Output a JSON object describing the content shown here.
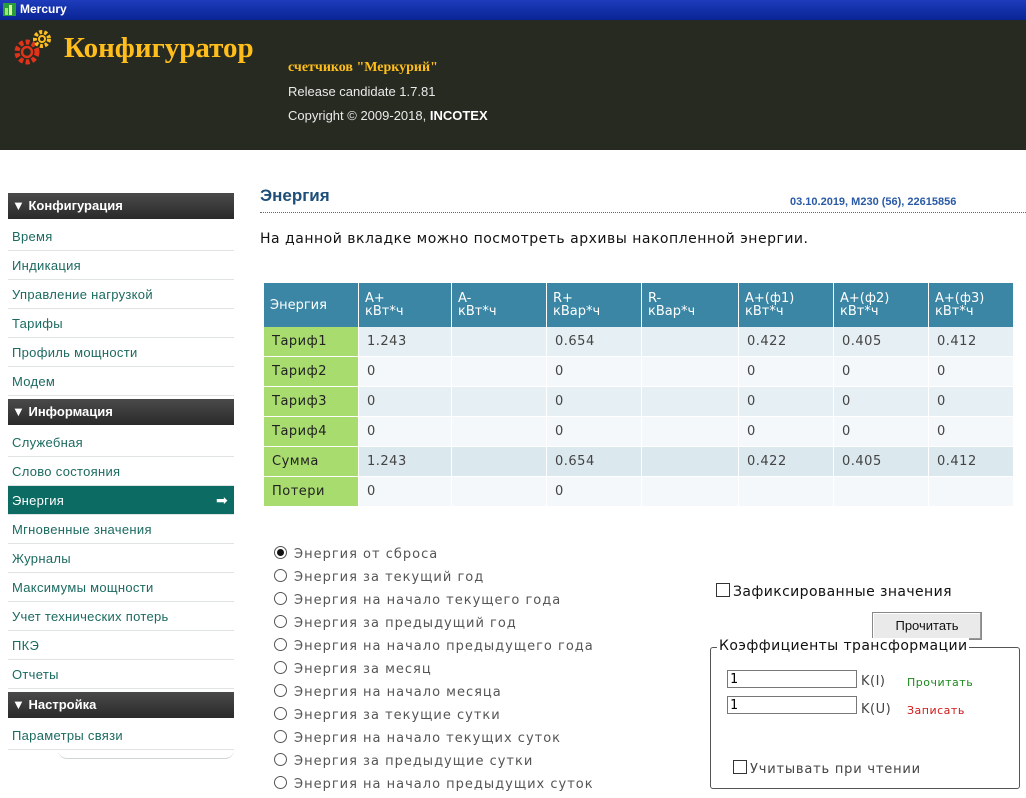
{
  "window": {
    "title": "Mercury"
  },
  "header": {
    "brand": "Конфигуратор",
    "subtitle": "счетчиков \"Меркурий\"",
    "release": "Release candidate 1.7.81",
    "copyright_prefix": "Copyright © 2009-2018, ",
    "copyright_company": "INCOTEX"
  },
  "sidebar": {
    "sections": [
      {
        "title": "▼ Конфигурация",
        "items": [
          "Время",
          "Индикация",
          "Управление нагрузкой",
          "Тарифы",
          "Профиль мощности",
          "Модем"
        ]
      },
      {
        "title": "▼ Информация",
        "items": [
          "Служебная",
          "Слово состояния",
          "Энергия",
          "Мгновенные значения",
          "Журналы",
          "Максимумы мощности",
          "Учет технических потерь",
          "ПКЭ",
          "Отчеты"
        ]
      },
      {
        "title": "▼ Настройка",
        "items": [
          "Параметры связи"
        ]
      }
    ],
    "active_item": "Энергия",
    "active_arrow": "➡"
  },
  "main": {
    "title": "Энергия",
    "meta": "03.10.2019, M230 (56), 22615856",
    "description": "На данной вкладке можно посмотреть архивы накопленной энергии."
  },
  "table": {
    "headers": [
      [
        "Энергия"
      ],
      [
        "A+",
        "кВт*ч"
      ],
      [
        "A-",
        "кВт*ч"
      ],
      [
        "R+",
        "кВар*ч"
      ],
      [
        "R-",
        "кВар*ч"
      ],
      [
        "A+(ф1)",
        "кВт*ч"
      ],
      [
        "A+(ф2)",
        "кВт*ч"
      ],
      [
        "A+(ф3)",
        "кВт*ч"
      ]
    ],
    "rows": [
      {
        "label": "Тариф1",
        "cells": [
          "1.243",
          "",
          "0.654",
          "",
          "0.422",
          "0.405",
          "0.412"
        ]
      },
      {
        "label": "Тариф2",
        "cells": [
          "0",
          "",
          "0",
          "",
          "0",
          "0",
          "0"
        ]
      },
      {
        "label": "Тариф3",
        "cells": [
          "0",
          "",
          "0",
          "",
          "0",
          "0",
          "0"
        ]
      },
      {
        "label": "Тариф4",
        "cells": [
          "0",
          "",
          "0",
          "",
          "0",
          "0",
          "0"
        ]
      },
      {
        "label": "Сумма",
        "cells": [
          "1.243",
          "",
          "0.654",
          "",
          "0.422",
          "0.405",
          "0.412"
        ]
      },
      {
        "label": "Потери",
        "cells": [
          "0",
          "",
          "0",
          "",
          "",
          "",
          ""
        ]
      }
    ]
  },
  "period_options": [
    "Энергия от сброса",
    "Энергия за текущий год",
    "Энергия на начало текущего года",
    "Энергия за предыдущий год",
    "Энергия на начало предыдущего года",
    "Энергия за месяц",
    "Энергия на начало месяца",
    "Энергия за текущие сутки",
    "Энергия на начало текущих суток",
    "Энергия за предыдущие сутки",
    "Энергия на начало предыдущих суток"
  ],
  "period_selected": 0,
  "fixed_values": {
    "label": "Зафиксированные значения",
    "checked": false
  },
  "read_button": "Прочитать",
  "transform": {
    "legend": "Коэффициенты трансформации",
    "k_i_value": "1",
    "k_i_label": "K(I)",
    "k_u_value": "1",
    "k_u_label": "K(U)",
    "read_link": "Прочитать",
    "write_link": "Записать",
    "consider_label": "Учитывать при чтении",
    "consider_checked": false
  }
}
